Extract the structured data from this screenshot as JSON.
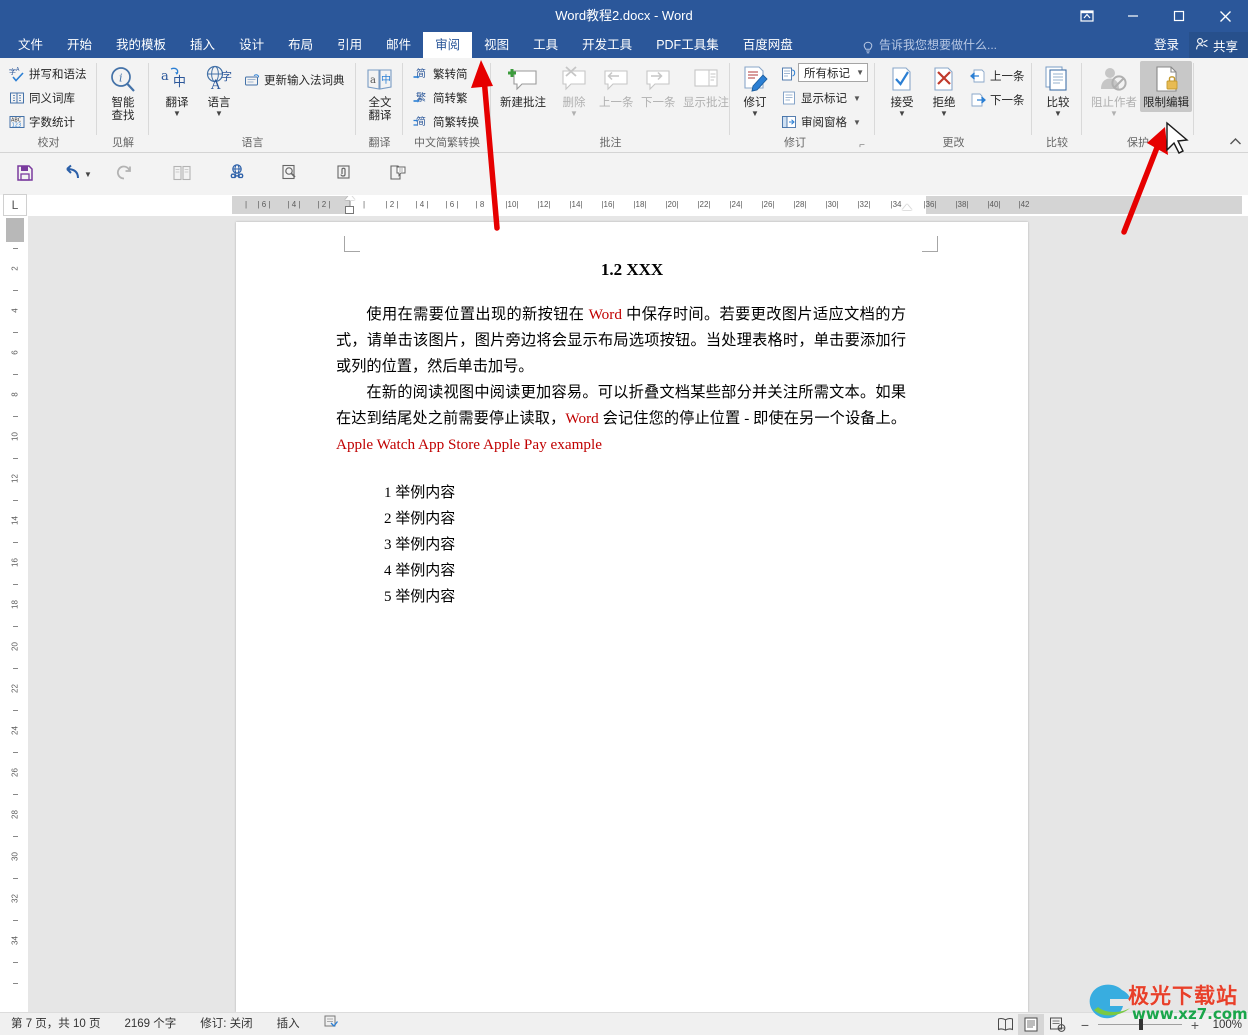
{
  "window": {
    "title": "Word教程2.docx - Word",
    "buttons": {
      "ribbon_display": "ribbon-display-options-icon",
      "minimize": "minimize-icon",
      "maximize": "maximize-icon",
      "close": "close-icon"
    }
  },
  "ribbon_tabs": [
    {
      "label": "文件",
      "active": false
    },
    {
      "label": "开始",
      "active": false
    },
    {
      "label": "我的模板",
      "active": false
    },
    {
      "label": "插入",
      "active": false
    },
    {
      "label": "设计",
      "active": false
    },
    {
      "label": "布局",
      "active": false
    },
    {
      "label": "引用",
      "active": false
    },
    {
      "label": "邮件",
      "active": false
    },
    {
      "label": "审阅",
      "active": true
    },
    {
      "label": "视图",
      "active": false
    },
    {
      "label": "工具",
      "active": false
    },
    {
      "label": "开发工具",
      "active": false
    },
    {
      "label": "PDF工具集",
      "active": false
    },
    {
      "label": "百度网盘",
      "active": false
    }
  ],
  "tell_me": {
    "placeholder": "告诉我您想要做什么...",
    "icon": "lightbulb-icon"
  },
  "account": {
    "sign_in": "登录",
    "share": "共享",
    "share_icon": "share-person-icon"
  },
  "ribbon_groups": [
    {
      "name": "校对",
      "items": [
        {
          "label": "拼写和语法",
          "icon": "spelling-grammar-icon",
          "type": "small"
        },
        {
          "label": "同义词库",
          "icon": "thesaurus-icon",
          "type": "small"
        },
        {
          "label": "字数统计",
          "icon": "word-count-icon",
          "type": "small"
        }
      ]
    },
    {
      "name": "见解",
      "items": [
        {
          "label": "智能\n查找",
          "label_l1": "智能",
          "label_l2": "查找",
          "icon": "smart-lookup-icon",
          "type": "big"
        }
      ]
    },
    {
      "name": "语言",
      "items": [
        {
          "label": "翻译",
          "icon": "translate-icon",
          "type": "big",
          "dropdown": true
        },
        {
          "label": "语言",
          "icon": "language-icon",
          "type": "big",
          "dropdown": true
        },
        {
          "label": "更新输入法词典",
          "icon": "update-ime-dictionary-icon",
          "type": "small"
        }
      ]
    },
    {
      "name": "翻译",
      "items": [
        {
          "label_l1": "全文",
          "label_l2": "翻译",
          "icon": "full-text-translate-icon",
          "type": "big"
        }
      ]
    },
    {
      "name": "中文简繁转换",
      "items": [
        {
          "label": "繁转简",
          "icon": "trad-to-simp-icon",
          "type": "small"
        },
        {
          "label": "简转繁",
          "icon": "simp-to-trad-icon",
          "type": "small"
        },
        {
          "label": "简繁转换",
          "icon": "simp-trad-convert-icon",
          "type": "small"
        }
      ]
    },
    {
      "name": "批注",
      "items": [
        {
          "label": "新建批注",
          "icon": "new-comment-icon",
          "type": "big"
        },
        {
          "label": "删除",
          "icon": "delete-comment-icon",
          "type": "big",
          "dropdown": true,
          "disabled": true
        },
        {
          "label": "上一条",
          "icon": "previous-comment-icon",
          "type": "big",
          "disabled": true
        },
        {
          "label": "下一条",
          "icon": "next-comment-icon",
          "type": "big",
          "disabled": true
        },
        {
          "label": "显示批注",
          "icon": "show-comments-icon",
          "type": "big",
          "disabled": true
        }
      ]
    },
    {
      "name": "修订",
      "items": [
        {
          "label": "修订",
          "icon": "track-changes-icon",
          "type": "big",
          "dropdown": true
        },
        {
          "value": "所有标记",
          "icon": "display-for-review-icon",
          "type": "combo"
        },
        {
          "label": "显示标记",
          "icon": "show-markup-icon",
          "type": "small",
          "dropdown": true
        },
        {
          "label": "审阅窗格",
          "icon": "reviewing-pane-icon",
          "type": "small",
          "dropdown": true
        }
      ],
      "dialog_launcher": "dialog-launcher-icon"
    },
    {
      "name": "更改",
      "items": [
        {
          "label": "接受",
          "icon": "accept-change-icon",
          "type": "big",
          "dropdown": true
        },
        {
          "label": "拒绝",
          "icon": "reject-change-icon",
          "type": "big",
          "dropdown": true
        },
        {
          "label": "上一条",
          "icon": "previous-change-icon",
          "type": "small"
        },
        {
          "label": "下一条",
          "icon": "next-change-icon",
          "type": "small"
        }
      ]
    },
    {
      "name": "比较",
      "items": [
        {
          "label": "比较",
          "icon": "compare-icon",
          "type": "big",
          "dropdown": true
        }
      ]
    },
    {
      "name": "保护",
      "items": [
        {
          "label": "阻止作者",
          "icon": "block-authors-icon",
          "type": "big",
          "dropdown": true,
          "disabled": true
        },
        {
          "label": "限制编辑",
          "icon": "restrict-editing-icon",
          "type": "big",
          "selected": true
        }
      ]
    }
  ],
  "quick_access": [
    {
      "name": "save-icon",
      "glyph": "save"
    },
    {
      "name": "undo-icon",
      "glyph": "undo",
      "dropdown": true
    },
    {
      "name": "redo-icon",
      "glyph": "redo"
    },
    {
      "name": "two-page-view-icon",
      "glyph": "twopage"
    },
    {
      "name": "web-link-icon",
      "glyph": "weblink"
    },
    {
      "name": "print-preview-icon",
      "glyph": "preview"
    },
    {
      "name": "attach-icon",
      "glyph": "attach"
    },
    {
      "name": "compare-doc-icon",
      "glyph": "comparedoc"
    }
  ],
  "ruler": {
    "corner_label": "L",
    "h_ticks": [
      "6",
      "4",
      "2",
      "2",
      "4",
      "6",
      "8",
      "10",
      "12",
      "14",
      "16",
      "18",
      "20",
      "22",
      "24",
      "26",
      "28",
      "30",
      "32",
      "34",
      "36",
      "38",
      "40",
      "42"
    ],
    "v_ticks": [
      "2",
      "4",
      "6",
      "8",
      "10",
      "12",
      "14",
      "16",
      "18",
      "20",
      "22",
      "24",
      "26",
      "28",
      "30",
      "32",
      "34"
    ]
  },
  "document": {
    "heading": "1.2 XXX",
    "paragraphs": [
      {
        "runs": [
          {
            "text": "使用在需要位置出现的新按钮在 ",
            "red": false
          },
          {
            "text": "Word",
            "red": true
          },
          {
            "text": " 中保存时间。若要更改图片适应文档的方式，请单击该图片，图片旁边将会显示布局选项按钮。当处理表格时，单击要添加行或列的位置，然后单击加号。",
            "red": false
          }
        ]
      },
      {
        "runs": [
          {
            "text": "在新的阅读视图中阅读更加容易。可以折叠文档某些部分并关注所需文本。如果在达到结尾处之前需要停止读取，",
            "red": false
          },
          {
            "text": "Word",
            "red": true
          },
          {
            "text": " 会记住您的停止位置 - 即使在另一个设备上。",
            "red": false
          },
          {
            "text": "Apple Watch",
            "red": true
          },
          {
            "text": "   ",
            "red": false
          },
          {
            "text": "App Store",
            "red": true
          },
          {
            "text": "   ",
            "red": false
          },
          {
            "text": "Apple Pay",
            "red": true
          },
          {
            "text": "   ",
            "red": false
          },
          {
            "text": "example",
            "red": true
          }
        ]
      }
    ],
    "list": [
      "1 举例内容",
      "2 举例内容",
      "3 举例内容",
      "4 举例内容",
      "5 举例内容"
    ]
  },
  "status_bar": {
    "page": "第 7 页，共 10 页",
    "words": "2169 个字",
    "track_changes": "修订: 关闭",
    "insert_mode": "插入",
    "proofing_icon": "proofing-status-icon",
    "views": [
      {
        "name": "read-mode-icon",
        "active": false
      },
      {
        "name": "print-layout-icon",
        "active": true
      },
      {
        "name": "web-layout-icon",
        "active": false
      }
    ],
    "zoom": {
      "minus": "−",
      "plus": "+",
      "value": "100%"
    }
  },
  "watermark": {
    "text": "极光下载站",
    "url": "www.xz7.com"
  },
  "annotations": {
    "arrow1": "red-arrow-pointing-to-review-tab",
    "arrow2": "red-arrow-pointing-to-restrict-editing",
    "cursor": "mouse-cursor"
  },
  "colors": {
    "accent": "#2b579a",
    "ribbon_bg": "#f3f3f3",
    "doc_bg": "#e6e6e6",
    "red_text": "#c00000",
    "arrow_red": "#e60000"
  }
}
